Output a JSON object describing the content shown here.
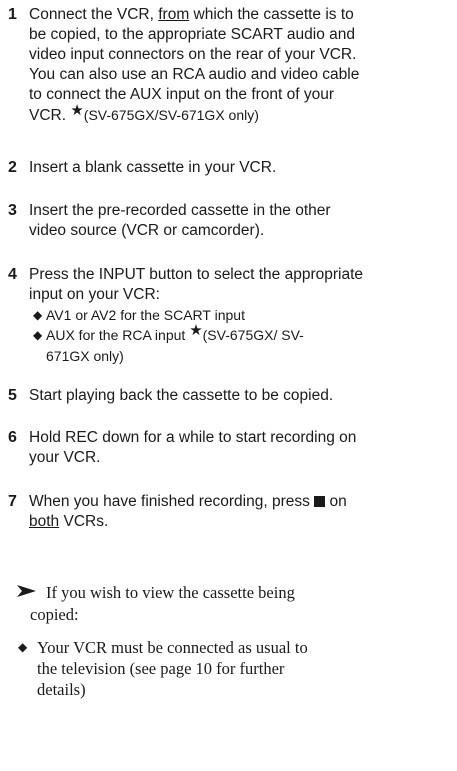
{
  "steps": [
    {
      "num": "1",
      "l1a": "Connect the VCR, ",
      "l1u": "from",
      "l1b": " which the cassette is to",
      "l2": "be copied, to the appropriate SCART audio and",
      "l3": "video input connectors on the rear of your VCR.",
      "l4": "You can also use an RCA audio and video cable",
      "l5": "to connect the AUX input on the front of your",
      "l6": "VCR. ",
      "star": "★",
      "l6b": "(SV-675GX/SV-671GX only)"
    },
    {
      "num": "2",
      "text": "Insert a blank cassette in your VCR."
    },
    {
      "num": "3",
      "l1": "Insert the pre-recorded cassette in the other",
      "l2": "video source (VCR or camcorder)."
    },
    {
      "num": "4",
      "l1": "Press the INPUT button to select the appropriate",
      "l2": "input on your VCR:",
      "b1": "AV1 or AV2 for the SCART input",
      "b2a": "AUX for the RCA input ",
      "b2b": "(SV-675GX/ SV-",
      "b2c": "671GX only)",
      "star": "★",
      "diamond": "◆"
    },
    {
      "num": "5",
      "text": "Start playing back the cassette to be copied."
    },
    {
      "num": "6",
      "l1": "Hold REC down for a while to start recording on",
      "l2": "your VCR."
    },
    {
      "num": "7",
      "l1": "When you have finished recording, press",
      "l1b": "on",
      "l2u": "both",
      "l2b": " VCRs."
    }
  ],
  "note": {
    "l1": "If you wish to view the cassette being",
    "l2": "copied:",
    "b1": "Your VCR must be connected as usual to",
    "b2": "the television (see page 10 for further",
    "b3": "details)",
    "diamond": "◆"
  }
}
